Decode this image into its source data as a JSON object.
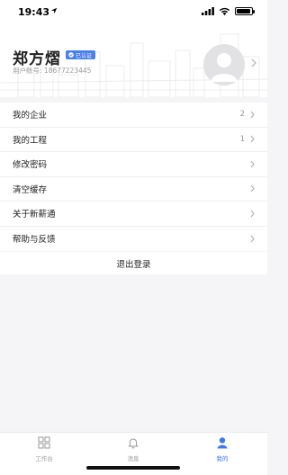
{
  "status_bar": {
    "time": "19:43"
  },
  "profile": {
    "name": "郑方熠",
    "verified_label": "已认证",
    "account_label": "用户账号:",
    "account_number": "18677223445"
  },
  "menu": {
    "items": [
      {
        "label": "我的企业",
        "count": "2"
      },
      {
        "label": "我的工程",
        "count": "1"
      },
      {
        "label": "修改密码",
        "count": ""
      },
      {
        "label": "清空缓存",
        "count": ""
      },
      {
        "label": "关于新薪通",
        "count": ""
      },
      {
        "label": "帮助与反馈",
        "count": ""
      }
    ]
  },
  "logout_label": "退出登录",
  "tab_bar": {
    "tabs": [
      {
        "label": "工作台",
        "icon": "grid-icon"
      },
      {
        "label": "消息",
        "icon": "bell-icon"
      },
      {
        "label": "我的",
        "icon": "user-icon"
      }
    ],
    "active_color": "#3c78ee"
  }
}
